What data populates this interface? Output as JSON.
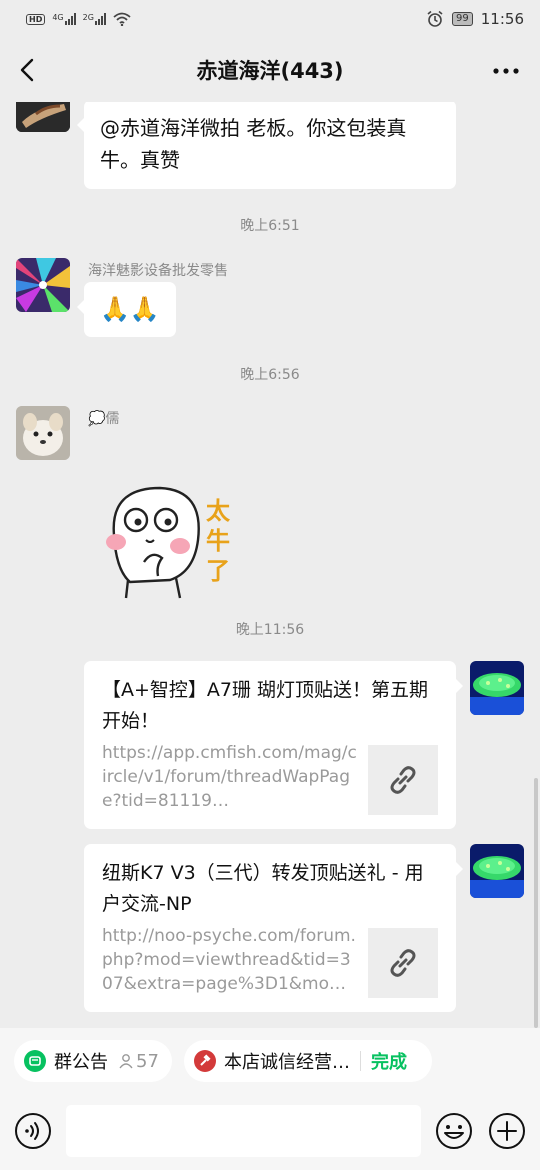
{
  "status_bar": {
    "network_left": "HD",
    "signal_1": "4G",
    "signal_2": "2G",
    "battery": "99",
    "time": "11:56"
  },
  "nav": {
    "title": "赤道海洋(443)",
    "back_icon": "back-arrow-icon",
    "more_icon": "more-dots-icon"
  },
  "messages": {
    "m1_text": "@赤道海洋微拍  老板。你这包装真牛。真赞",
    "ts1": "晚上6:51",
    "m2_sender": "海洋魅影设备批发零售",
    "m2_text": "🙏🙏",
    "ts2": "晚上6:56",
    "m3_sender": "💭儒",
    "sticker_text": "太牛了",
    "ts3": "晚上11:56",
    "link1_title": "【A+智控】A7珊 瑚灯顶贴送！第五期开始！",
    "link1_url": "https://app.cmfish.com/mag/circle/v1/forum/threadWapPage?tid=81119…",
    "link2_title": "纽斯K7 V3（三代）转发顶贴送礼 - 用户交流-NP",
    "link2_url": "http://noo-psyche.com/forum.php?mod=viewthread&tid=307&extra=page%3D1&mo…"
  },
  "tips": {
    "notice_label": "群公告",
    "notice_count": "57",
    "shop_label": "本店诚信经营…",
    "done_label": "完成"
  },
  "input": {
    "voice_icon": "voice-icon",
    "emoji_icon": "emoji-icon",
    "plus_icon": "plus-icon"
  },
  "colors": {
    "accent_green": "#07c160",
    "background": "#ededed",
    "bubble": "#ffffff"
  }
}
